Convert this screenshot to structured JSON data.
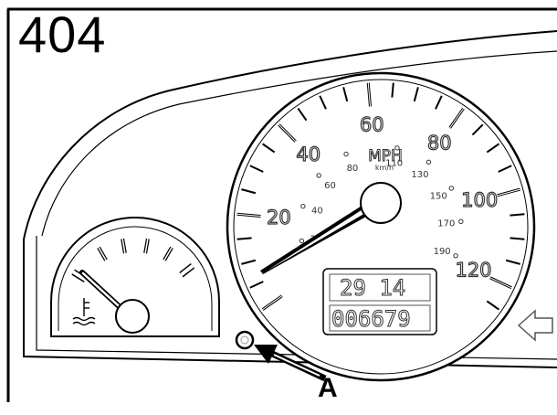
{
  "figure": {
    "number": "404",
    "callout_label": "A"
  },
  "speedometer": {
    "unit_primary": "MPH",
    "unit_secondary": "km/h",
    "mph_labels": [
      "20",
      "40",
      "60",
      "80",
      "100",
      "120"
    ],
    "kmh_labels": [
      "20",
      "40",
      "60",
      "80",
      "110",
      "130",
      "150",
      "170",
      "190"
    ]
  },
  "odometer": {
    "trip": "29 14",
    "total": "006679"
  },
  "temperature_gauge": {
    "icon": "coolant-temperature-icon"
  },
  "icons": {
    "turn_indicator": "left-arrow-icon",
    "callout_arrow": "arrow-icon"
  }
}
